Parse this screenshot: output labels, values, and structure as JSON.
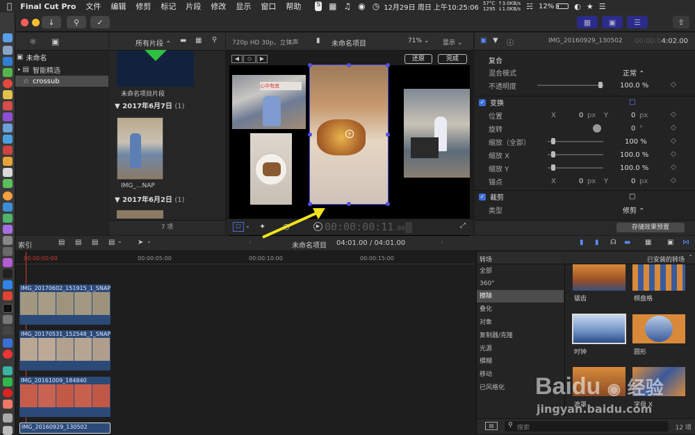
{
  "menubar": {
    "app": "Final Cut Pro",
    "items": [
      "文件",
      "编辑",
      "修剪",
      "标记",
      "片段",
      "修改",
      "显示",
      "窗口",
      "帮助"
    ],
    "temp": "57°C",
    "fan": "1295",
    "net_up": "↑3.0KB/s",
    "net_down": "↓1.0KB/s",
    "battery": "12%",
    "datetime": "12月29日 周日 上午10:25:06"
  },
  "library": {
    "root": "未命名",
    "items": [
      "智能精选",
      "crossub"
    ]
  },
  "browser": {
    "filter": "所有片段",
    "project_clip_label": "未命名项目片段",
    "date1": "2017年6月7日",
    "date1_count": "(1)",
    "clip_name": "IMG_...NAP",
    "date2": "2017年6月2日",
    "date2_count": "(1)",
    "footer_count": "7 项"
  },
  "viewer": {
    "format": "720p HD 30p，立体声",
    "project": "未命名项目",
    "zoom": "71%",
    "view_menu": "显示",
    "restore_btn": "还原",
    "done_btn": "完成",
    "timecode": "00:00:00:11",
    "timecode_frac": ".00"
  },
  "inspector": {
    "clip_name": "IMG_20160929_130502",
    "duration": "4:02.00",
    "composite_title": "复合",
    "blend_label": "混合模式",
    "blend_value": "正常",
    "opacity_label": "不透明度",
    "opacity_value": "100.0 %",
    "opacity_level": 1.0,
    "transform_title": "变换",
    "position_label": "位置",
    "x_axis": "X",
    "y_axis": "Y",
    "pos_x": "0",
    "pos_y": "0",
    "unit_px": "px",
    "rotation_label": "旋转",
    "rotation_value": "0",
    "unit_deg": "°",
    "scale_all_label": "缩放（全部）",
    "scale_all_value": "100 %",
    "scale_x_label": "缩放 X",
    "scale_x_value": "100.0 %",
    "scale_y_label": "缩放 Y",
    "scale_y_value": "100.0 %",
    "anchor_label": "锚点",
    "anchor_x": "0",
    "anchor_y": "0",
    "crop_title": "裁剪",
    "type_label": "类型",
    "type_value": "修剪",
    "save_preset": "存储效果预置"
  },
  "timeline": {
    "index_label": "索引",
    "project": "未命名项目",
    "duration": "04:01.00 / 04:01.00",
    "ruler": [
      "00:00:00:00",
      "00:00:05:00",
      "00:00:10:00",
      "00:00:15:00"
    ],
    "clips": [
      "IMG_20170602_151915_1_SNAP",
      "IMG_20170531_152548_1_SNAP",
      "IMG_20161009_184840",
      "IMG_20160929_130502"
    ]
  },
  "transitions": {
    "title": "转场",
    "installed": "已安装的转场",
    "categories": [
      "全部",
      "360°",
      "擦除",
      "叠化",
      "对象",
      "复制器/克隆",
      "光源",
      "模糊",
      "移动",
      "已风格化"
    ],
    "selected_index": 2,
    "items": [
      "锯齿",
      "棋盘格",
      "时钟",
      "圆形",
      "遮罩",
      "字母 X"
    ],
    "search_placeholder": "搜索",
    "count": "12 项"
  },
  "watermark": {
    "brand": "Baidu",
    "brand2": "经验",
    "url": "jingyan.baidu.com"
  },
  "colors": {
    "accent": "#3b6fd6",
    "clip_blue": "#2c4a78",
    "playhead": "#d03c2f",
    "arrow": "#f2e21c",
    "selection": "#5050e0"
  }
}
